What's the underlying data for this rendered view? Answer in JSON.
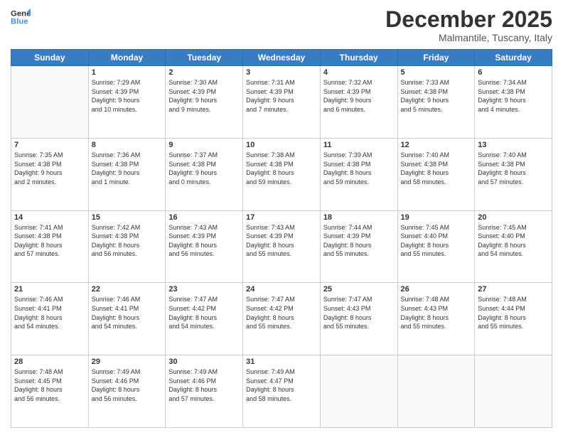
{
  "header": {
    "logo_line1": "General",
    "logo_line2": "Blue",
    "month": "December 2025",
    "location": "Malmantile, Tuscany, Italy"
  },
  "weekdays": [
    "Sunday",
    "Monday",
    "Tuesday",
    "Wednesday",
    "Thursday",
    "Friday",
    "Saturday"
  ],
  "weeks": [
    [
      {
        "day": "",
        "info": ""
      },
      {
        "day": "1",
        "info": "Sunrise: 7:29 AM\nSunset: 4:39 PM\nDaylight: 9 hours\nand 10 minutes."
      },
      {
        "day": "2",
        "info": "Sunrise: 7:30 AM\nSunset: 4:39 PM\nDaylight: 9 hours\nand 9 minutes."
      },
      {
        "day": "3",
        "info": "Sunrise: 7:31 AM\nSunset: 4:39 PM\nDaylight: 9 hours\nand 7 minutes."
      },
      {
        "day": "4",
        "info": "Sunrise: 7:32 AM\nSunset: 4:39 PM\nDaylight: 9 hours\nand 6 minutes."
      },
      {
        "day": "5",
        "info": "Sunrise: 7:33 AM\nSunset: 4:38 PM\nDaylight: 9 hours\nand 5 minutes."
      },
      {
        "day": "6",
        "info": "Sunrise: 7:34 AM\nSunset: 4:38 PM\nDaylight: 9 hours\nand 4 minutes."
      }
    ],
    [
      {
        "day": "7",
        "info": "Sunrise: 7:35 AM\nSunset: 4:38 PM\nDaylight: 9 hours\nand 2 minutes."
      },
      {
        "day": "8",
        "info": "Sunrise: 7:36 AM\nSunset: 4:38 PM\nDaylight: 9 hours\nand 1 minute."
      },
      {
        "day": "9",
        "info": "Sunrise: 7:37 AM\nSunset: 4:38 PM\nDaylight: 9 hours\nand 0 minutes."
      },
      {
        "day": "10",
        "info": "Sunrise: 7:38 AM\nSunset: 4:38 PM\nDaylight: 8 hours\nand 59 minutes."
      },
      {
        "day": "11",
        "info": "Sunrise: 7:39 AM\nSunset: 4:38 PM\nDaylight: 8 hours\nand 59 minutes."
      },
      {
        "day": "12",
        "info": "Sunrise: 7:40 AM\nSunset: 4:38 PM\nDaylight: 8 hours\nand 58 minutes."
      },
      {
        "day": "13",
        "info": "Sunrise: 7:40 AM\nSunset: 4:38 PM\nDaylight: 8 hours\nand 57 minutes."
      }
    ],
    [
      {
        "day": "14",
        "info": "Sunrise: 7:41 AM\nSunset: 4:38 PM\nDaylight: 8 hours\nand 57 minutes."
      },
      {
        "day": "15",
        "info": "Sunrise: 7:42 AM\nSunset: 4:38 PM\nDaylight: 8 hours\nand 56 minutes."
      },
      {
        "day": "16",
        "info": "Sunrise: 7:43 AM\nSunset: 4:39 PM\nDaylight: 8 hours\nand 56 minutes."
      },
      {
        "day": "17",
        "info": "Sunrise: 7:43 AM\nSunset: 4:39 PM\nDaylight: 8 hours\nand 55 minutes."
      },
      {
        "day": "18",
        "info": "Sunrise: 7:44 AM\nSunset: 4:39 PM\nDaylight: 8 hours\nand 55 minutes."
      },
      {
        "day": "19",
        "info": "Sunrise: 7:45 AM\nSunset: 4:40 PM\nDaylight: 8 hours\nand 55 minutes."
      },
      {
        "day": "20",
        "info": "Sunrise: 7:45 AM\nSunset: 4:40 PM\nDaylight: 8 hours\nand 54 minutes."
      }
    ],
    [
      {
        "day": "21",
        "info": "Sunrise: 7:46 AM\nSunset: 4:41 PM\nDaylight: 8 hours\nand 54 minutes."
      },
      {
        "day": "22",
        "info": "Sunrise: 7:46 AM\nSunset: 4:41 PM\nDaylight: 8 hours\nand 54 minutes."
      },
      {
        "day": "23",
        "info": "Sunrise: 7:47 AM\nSunset: 4:42 PM\nDaylight: 8 hours\nand 54 minutes."
      },
      {
        "day": "24",
        "info": "Sunrise: 7:47 AM\nSunset: 4:42 PM\nDaylight: 8 hours\nand 55 minutes."
      },
      {
        "day": "25",
        "info": "Sunrise: 7:47 AM\nSunset: 4:43 PM\nDaylight: 8 hours\nand 55 minutes."
      },
      {
        "day": "26",
        "info": "Sunrise: 7:48 AM\nSunset: 4:43 PM\nDaylight: 8 hours\nand 55 minutes."
      },
      {
        "day": "27",
        "info": "Sunrise: 7:48 AM\nSunset: 4:44 PM\nDaylight: 8 hours\nand 55 minutes."
      }
    ],
    [
      {
        "day": "28",
        "info": "Sunrise: 7:48 AM\nSunset: 4:45 PM\nDaylight: 8 hours\nand 56 minutes."
      },
      {
        "day": "29",
        "info": "Sunrise: 7:49 AM\nSunset: 4:46 PM\nDaylight: 8 hours\nand 56 minutes."
      },
      {
        "day": "30",
        "info": "Sunrise: 7:49 AM\nSunset: 4:46 PM\nDaylight: 8 hours\nand 57 minutes."
      },
      {
        "day": "31",
        "info": "Sunrise: 7:49 AM\nSunset: 4:47 PM\nDaylight: 8 hours\nand 58 minutes."
      },
      {
        "day": "",
        "info": ""
      },
      {
        "day": "",
        "info": ""
      },
      {
        "day": "",
        "info": ""
      }
    ]
  ]
}
